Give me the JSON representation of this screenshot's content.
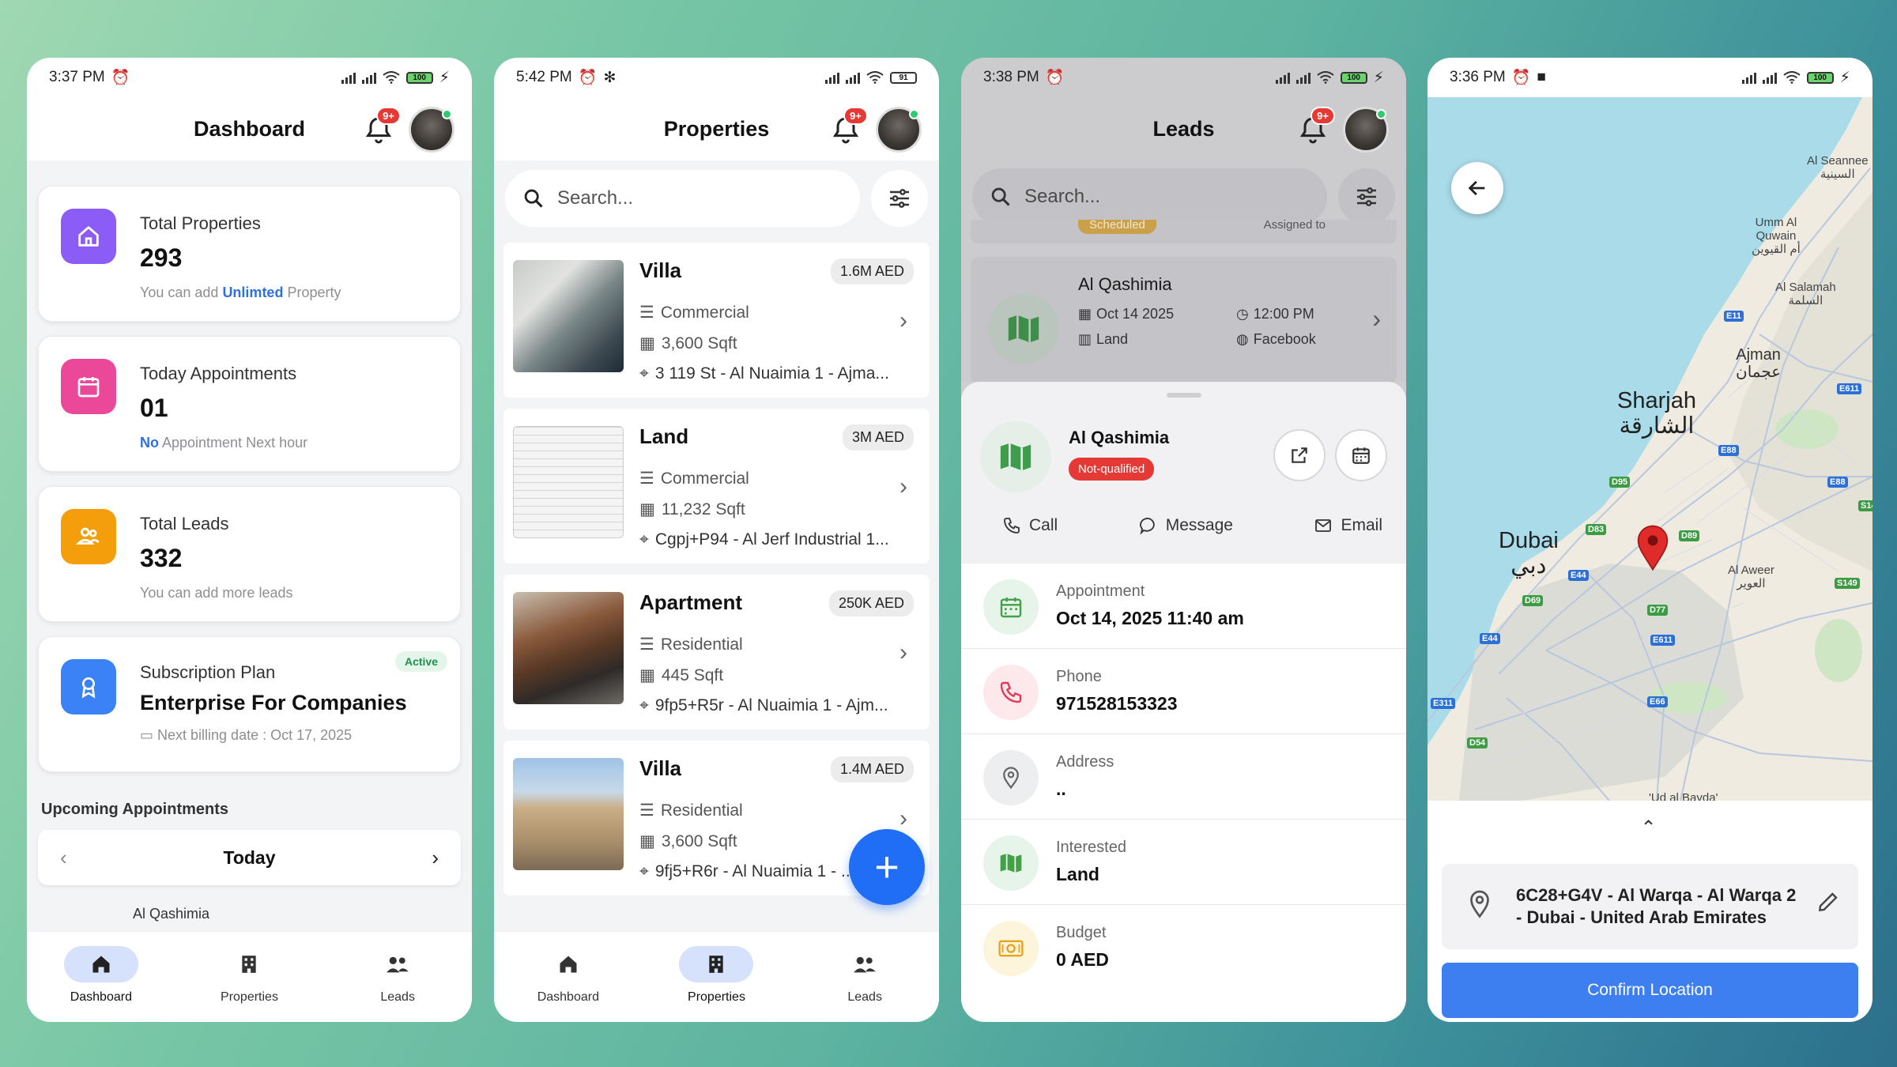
{
  "phones": {
    "dashboard": {
      "status_time": "3:37 PM",
      "battery": "100",
      "title": "Dashboard",
      "notification_badge": "9+",
      "cards": [
        {
          "label": "Total Properties",
          "value": "293",
          "note_prefix": "You can add ",
          "note_highlight": "Unlimted",
          "note_suffix": " Property"
        },
        {
          "label": "Today Appointments",
          "value": "01",
          "note_highlight": "No",
          "note_suffix": " Appointment Next hour"
        },
        {
          "label": "Total Leads",
          "value": "332",
          "note_suffix": "You can add more leads"
        },
        {
          "label": "Subscription Plan",
          "value": "Enterprise For Companies",
          "note_suffix": "Next billing date : Oct 17, 2025",
          "badge": "Active"
        }
      ],
      "upcoming_title": "Upcoming Appointments",
      "today_label": "Today",
      "peek_text": "Al Qashimia",
      "icon_colors": {
        "properties": "#8b5cf6",
        "appointments": "#ec4899",
        "leads": "#f59e0b",
        "subscription": "#3b82f6"
      }
    },
    "properties": {
      "status_time": "5:42 PM",
      "battery": "91",
      "title": "Properties",
      "notification_badge": "9+",
      "search_placeholder": "Search...",
      "items": [
        {
          "title": "Villa",
          "price": "1.6M AED",
          "type": "Commercial",
          "area": "3,600 Sqft",
          "address": "3 119 St - Al Nuaimia 1 - Ajma..."
        },
        {
          "title": "Land",
          "price": "3M AED",
          "type": "Commercial",
          "area": "11,232 Sqft",
          "address": "Cgpj+P94 - Al Jerf Industrial 1..."
        },
        {
          "title": "Apartment",
          "price": "250K AED",
          "type": "Residential",
          "area": "445 Sqft",
          "address": "9fp5+R5r - Al Nuaimia 1 - Ajm..."
        },
        {
          "title": "Villa",
          "price": "1.4M AED",
          "type": "Residential",
          "area": "3,600 Sqft",
          "address": "9fj5+R6r - Al Nuaimia 1 - ..."
        }
      ]
    },
    "leads": {
      "status_time": "3:38 PM",
      "battery": "100",
      "title": "Leads",
      "notification_badge": "9+",
      "search_placeholder": "Search...",
      "ghost_status": "Scheduled",
      "ghost_assigned": "Assigned to",
      "card": {
        "name": "Al Qashimia",
        "date": "Oct 14 2025",
        "time": "12:00 PM",
        "category": "Land",
        "source": "Facebook"
      },
      "sheet": {
        "name": "Al Qashimia",
        "status": "Not-qualified",
        "actions": {
          "call": "Call",
          "message": "Message",
          "email": "Email"
        },
        "rows": [
          {
            "label": "Appointment",
            "value": "Oct 14, 2025 11:40 am"
          },
          {
            "label": "Phone",
            "value": "971528153323"
          },
          {
            "label": "Address",
            "value": ".."
          },
          {
            "label": "Interested",
            "value": "Land"
          },
          {
            "label": "Budget",
            "value": "0 AED"
          }
        ]
      }
    },
    "location": {
      "status_time": "3:36 PM",
      "battery": "100",
      "map_labels": {
        "al_seannee": "Al Seannee\nالسينية",
        "umm_al_quwain": "Umm Al\nQuwain\nأم القيوين",
        "al_salamah": "Al Salamah\nالسلمة",
        "ajman": "Ajman\nعجمان",
        "sharjah": "Sharjah\nالشارقة",
        "dubai": "Dubai\nدبي",
        "al_aweer": "Al Aweer\nالعوير",
        "ud_al_bayda": "'Ud al Bayda'"
      },
      "roads": [
        "E11",
        "E611",
        "E88",
        "E88",
        "D95",
        "D83",
        "D89",
        "S14",
        "E44",
        "D69",
        "D77",
        "E611",
        "S149",
        "E44",
        "E66",
        "E311",
        "D54"
      ],
      "address": "6C28+G4V - Al Warqa - Al Warqa 2 - Dubai - United Arab Emirates",
      "confirm_label": "Confirm Location"
    },
    "nav": {
      "dashboard": "Dashboard",
      "properties": "Properties",
      "leads": "Leads"
    }
  }
}
